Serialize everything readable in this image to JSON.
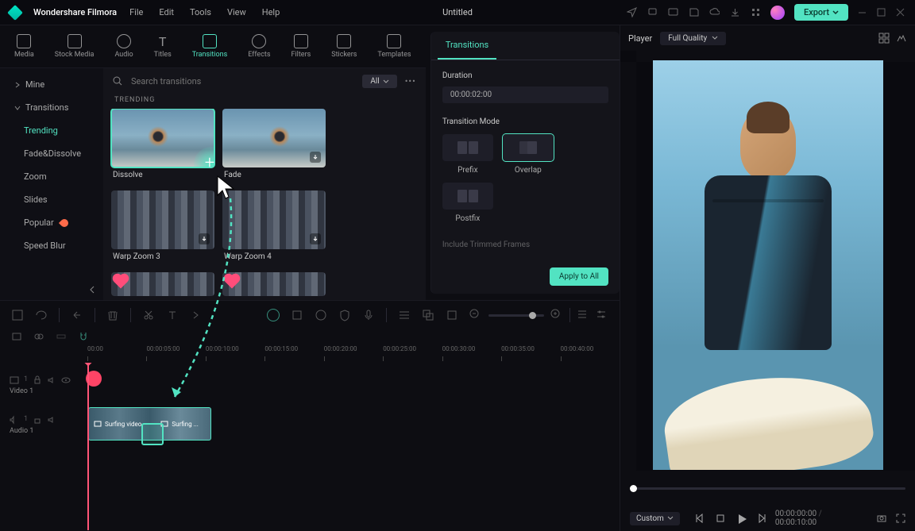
{
  "app": {
    "name": "Wondershare Filmora",
    "doc": "Untitled"
  },
  "menu": [
    "File",
    "Edit",
    "Tools",
    "View",
    "Help"
  ],
  "export": "Export",
  "toptabs": [
    {
      "label": "Media"
    },
    {
      "label": "Stock Media"
    },
    {
      "label": "Audio"
    },
    {
      "label": "Titles"
    },
    {
      "label": "Transitions",
      "active": true
    },
    {
      "label": "Effects"
    },
    {
      "label": "Filters"
    },
    {
      "label": "Stickers"
    },
    {
      "label": "Templates"
    }
  ],
  "sidebar": {
    "mine": "Mine",
    "transitions": "Transitions",
    "cats": [
      {
        "label": "Trending",
        "active": true
      },
      {
        "label": "Fade&Dissolve"
      },
      {
        "label": "Zoom"
      },
      {
        "label": "Slides"
      },
      {
        "label": "Popular",
        "hot": true
      },
      {
        "label": "Speed Blur"
      }
    ]
  },
  "search": {
    "placeholder": "Search transitions",
    "all": "All"
  },
  "section": "TRENDING",
  "cards": [
    {
      "label": "Dissolve",
      "kind": "surf",
      "selected": true
    },
    {
      "label": "Fade",
      "kind": "surf"
    },
    {
      "label": "Warp Zoom 3",
      "kind": "city"
    },
    {
      "label": "Warp Zoom 4",
      "kind": "city"
    },
    {
      "label": "",
      "kind": "city",
      "heart": true
    },
    {
      "label": "",
      "kind": "city",
      "heart": true
    }
  ],
  "props": {
    "tab": "Transitions",
    "durationLabel": "Duration",
    "duration": "00:00:02:00",
    "modeLabel": "Transition Mode",
    "modes": [
      {
        "label": "Prefix"
      },
      {
        "label": "Overlap",
        "selected": true
      },
      {
        "label": "Postfix"
      }
    ],
    "trimmed": "Include Trimmed Frames",
    "apply": "Apply to All"
  },
  "player": {
    "label": "Player",
    "quality": "Full Quality",
    "t1": "00:00:00:00",
    "t2": "00:00:10:00",
    "zoom": "Custom"
  },
  "timeline": {
    "ticks": [
      "00:00",
      "00:00:05:00",
      "00:00:10:00",
      "00:00:15:00",
      "00:00:20:00",
      "00:00:25:00",
      "00:00:30:00",
      "00:00:35:00",
      "00:00:40:00"
    ],
    "tracks": [
      {
        "name": "Video 1"
      },
      {
        "name": "Audio 1"
      }
    ],
    "clips": [
      {
        "name": "Surfing video"
      },
      {
        "name": "Surfing ..."
      }
    ]
  }
}
